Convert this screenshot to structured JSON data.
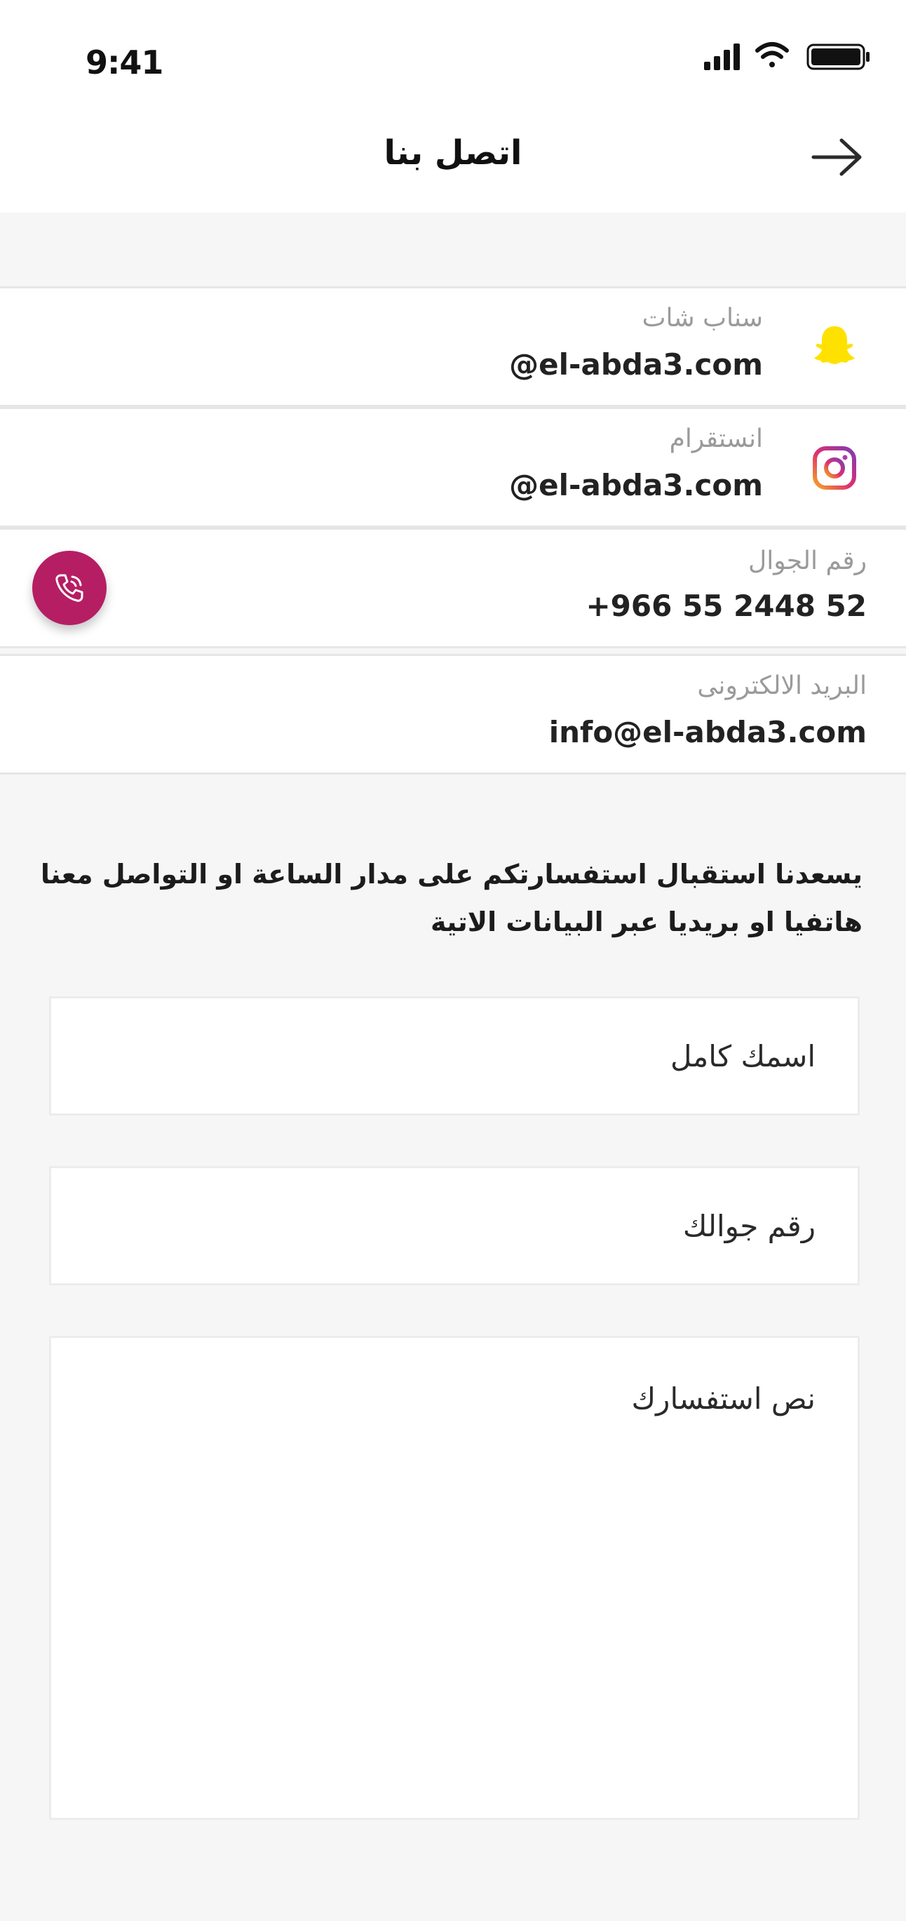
{
  "status_bar": {
    "time": "9:41"
  },
  "header": {
    "title": "اتصل بنا",
    "back_icon": "arrow-right-icon"
  },
  "contacts": {
    "snapchat": {
      "label": "سناب شات",
      "value": "@el-abda3.com",
      "icon": "snapchat-icon",
      "icon_color": "#FFE100"
    },
    "instagram": {
      "label": "انستقرام",
      "value": "@el-abda3.com",
      "icon": "instagram-icon"
    },
    "phone": {
      "label": "رقم الجوال",
      "value": "+966 55 2448 52",
      "call_icon": "phone-call-icon",
      "button_color": "#B51E63"
    },
    "email": {
      "label": "البريد الالكترونى",
      "value": "info@el-abda3.com"
    }
  },
  "intro_text": "يسعدنا استقبال استفسارتكم على مدار الساعة او التواصل معنا هاتفيا او بريديا عبر البيانات الاتية",
  "form": {
    "name_placeholder": "اسمك كامل",
    "phone_placeholder": "رقم جوالك",
    "message_placeholder": "نص استفسارك"
  }
}
